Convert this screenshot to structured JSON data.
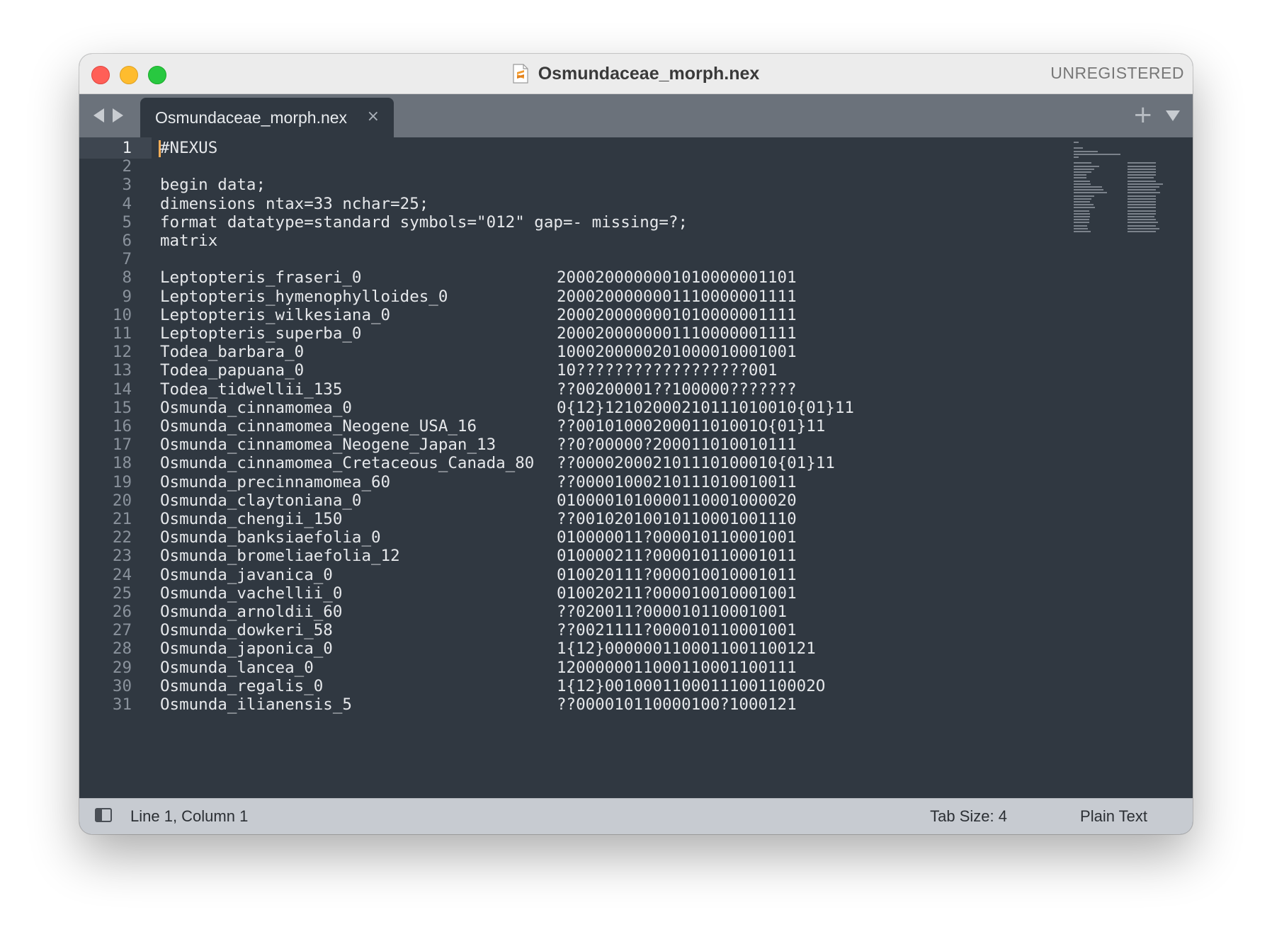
{
  "window": {
    "title": "Osmundaceae_morph.nex",
    "registration": "UNREGISTERED",
    "file_icon": "sublime-file-icon"
  },
  "tabs": {
    "active_label": "Osmundaceae_morph.nex",
    "close_glyph": "×",
    "add_glyph": "+"
  },
  "editor": {
    "header_lines": [
      {
        "n": "1",
        "text": "#NEXUS"
      },
      {
        "n": "2",
        "text": ""
      },
      {
        "n": "3",
        "text": "begin data;"
      },
      {
        "n": "4",
        "text": "dimensions ntax=33 nchar=25;"
      },
      {
        "n": "5",
        "text": "format datatype=standard symbols=\"012\" gap=- missing=?;"
      },
      {
        "n": "6",
        "text": "matrix"
      },
      {
        "n": "7",
        "text": ""
      }
    ],
    "matrix_rows": [
      {
        "n": "8",
        "taxon": "Leptopteris_fraseri_0",
        "chars": "2000200000001010000001101"
      },
      {
        "n": "9",
        "taxon": "Leptopteris_hymenophylloides_0",
        "chars": "2000200000001110000001111"
      },
      {
        "n": "10",
        "taxon": "Leptopteris_wilkesiana_0",
        "chars": "2000200000001010000001111"
      },
      {
        "n": "11",
        "taxon": "Leptopteris_superba_0",
        "chars": "2000200000001110000001111"
      },
      {
        "n": "12",
        "taxon": "Todea_barbara_0",
        "chars": "1000200000201000010001001"
      },
      {
        "n": "13",
        "taxon": "Todea_papuana_0",
        "chars": "10??????????????????001"
      },
      {
        "n": "14",
        "taxon": "Todea_tidwellii_135",
        "chars": "??00200001??100000???????"
      },
      {
        "n": "15",
        "taxon": "Osmunda_cinnamomea_0",
        "chars": "0{12}12102000210111010010{01}11"
      },
      {
        "n": "16",
        "taxon": "Osmunda_cinnamomea_Neogene_USA_16",
        "chars": "??0010100020001101001O{01}11"
      },
      {
        "n": "17",
        "taxon": "Osmunda_cinnamomea_Neogene_Japan_13",
        "chars": "??0?00000?200011010010111"
      },
      {
        "n": "18",
        "taxon": "Osmunda_cinnamomea_Cretaceous_Canada_80",
        "chars": "??000020002101110100010{01}11"
      },
      {
        "n": "19",
        "taxon": "Osmunda_precinnamomea_60",
        "chars": "??00001000210111010010011"
      },
      {
        "n": "20",
        "taxon": "Osmunda_claytoniana_0",
        "chars": "0100001010000110001000020"
      },
      {
        "n": "21",
        "taxon": "Osmunda_chengii_150",
        "chars": "??00102010010110001001110"
      },
      {
        "n": "22",
        "taxon": "Osmunda_banksiaefolia_0",
        "chars": "010000011?000010110001001"
      },
      {
        "n": "23",
        "taxon": "Osmunda_bromeliaefolia_12",
        "chars": "010000211?000010110001011"
      },
      {
        "n": "24",
        "taxon": "Osmunda_javanica_0",
        "chars": "010020111?000010010001011"
      },
      {
        "n": "25",
        "taxon": "Osmunda_vachellii_0",
        "chars": "010020211?000010010001001"
      },
      {
        "n": "26",
        "taxon": "Osmunda_arnoldii_60",
        "chars": "??020011?000010110001001"
      },
      {
        "n": "27",
        "taxon": "Osmunda_dowkeri_58",
        "chars": "??0021111?000010110001001"
      },
      {
        "n": "28",
        "taxon": "Osmunda_japonica_0",
        "chars": "1{12}0000001100011001100121"
      },
      {
        "n": "29",
        "taxon": "Osmunda_lancea_0",
        "chars": "1200000011000110001100111"
      },
      {
        "n": "30",
        "taxon": "Osmunda_regalis_0",
        "chars": "1{12}0010001100011100110002O"
      },
      {
        "n": "31",
        "taxon": "Osmunda_ilianensis_5",
        "chars": "??000010110000100?1000121"
      }
    ]
  },
  "status": {
    "position": "Line 1, Column 1",
    "tab_size": "Tab Size: 4",
    "syntax": "Plain Text"
  },
  "colors": {
    "editor_bg": "#303841",
    "tabbar_bg": "#6b727b",
    "statusbar_bg": "#c7cbd1",
    "cursor": "#f9ae58"
  }
}
